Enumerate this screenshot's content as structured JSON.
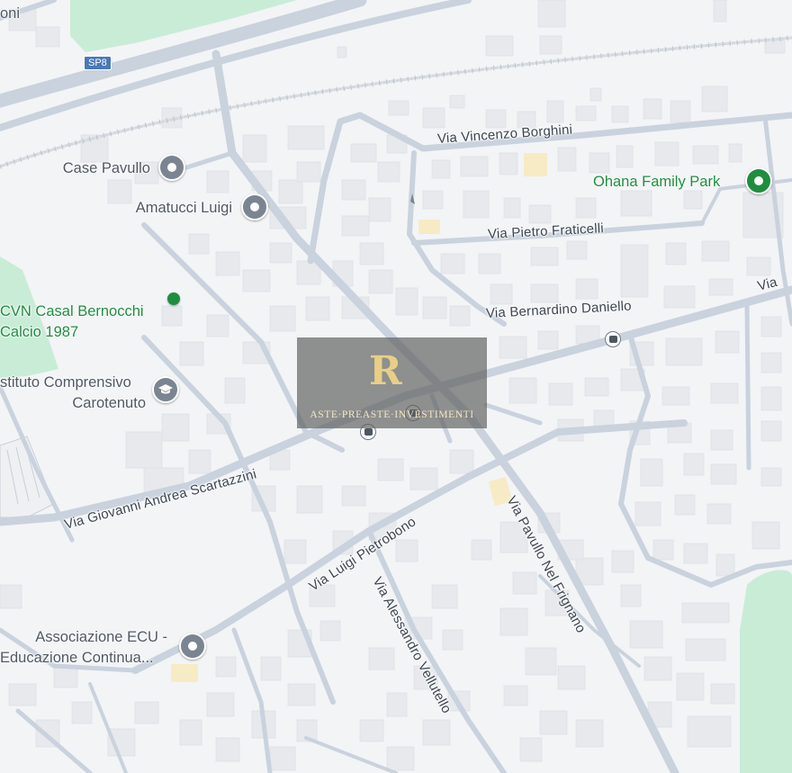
{
  "road_shield": "SP8",
  "streets": {
    "vincenzo_borghini": "Via Vincenzo Borghini",
    "pietro_fraticelli": "Via Pietro Fraticelli",
    "bernardino_daniello": "Via Bernardino Daniello",
    "via_partial": "Via",
    "scartazzini": "Via Giovanni Andrea Scartazzini",
    "pietrobono": "Via Luigi Pietrobono",
    "vellutello": "Via Alessandro Vellutello",
    "pavullo": "Via Pavullo Nel Frignano"
  },
  "places": {
    "top_left_partial": "oni",
    "case_pavullo": "Case Pavullo",
    "amatucci": "Amatucci Luigi",
    "ohana": "Ohana Family Park",
    "cvn_line1": "CVN Casal Bernocchi",
    "cvn_line2": "Calcio 1987",
    "istituto_line1": "stituto Comprensivo",
    "istituto_line2": "Carotenuto",
    "ecu_line1": "Associazione ECU -",
    "ecu_line2": "Educazione Continua..."
  },
  "watermark": {
    "logo": "R",
    "text": "ASTE·PREASTE·INVESTIMENTI"
  },
  "colors": {
    "background": "#f3f4f6",
    "road": "#c9d2dd",
    "park": "#c9ecd6",
    "building": "#e7e9ed",
    "poi_green": "#1e8e3e",
    "poi_grey": "#7b8591"
  }
}
